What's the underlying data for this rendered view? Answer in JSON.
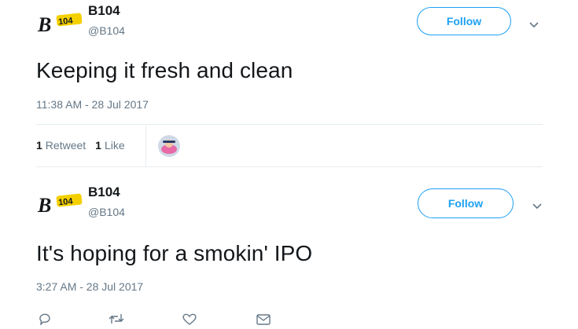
{
  "tweets": [
    {
      "account": {
        "name": "B104",
        "handle": "@B104",
        "logo_text": "B104"
      },
      "follow_label": "Follow",
      "text": "Keeping it fresh and clean",
      "timestamp": "11:38 AM - 28 Jul 2017",
      "stats": {
        "retweets_count": "1",
        "retweets_label": "Retweet",
        "likes_count": "1",
        "likes_label": "Like"
      }
    },
    {
      "account": {
        "name": "B104",
        "handle": "@B104",
        "logo_text": "B104"
      },
      "follow_label": "Follow",
      "text": "It's hoping for a smokin' IPO",
      "timestamp": "3:27 AM - 28 Jul 2017"
    }
  ],
  "colors": {
    "accent": "#1da1f2",
    "text": "#14171a",
    "secondary": "#657786",
    "divider": "#e6ecf0",
    "logo_yellow": "#f4d000"
  },
  "icons": [
    "chevron-down-icon",
    "reply-icon",
    "retweet-icon",
    "like-icon",
    "direct-message-icon"
  ]
}
